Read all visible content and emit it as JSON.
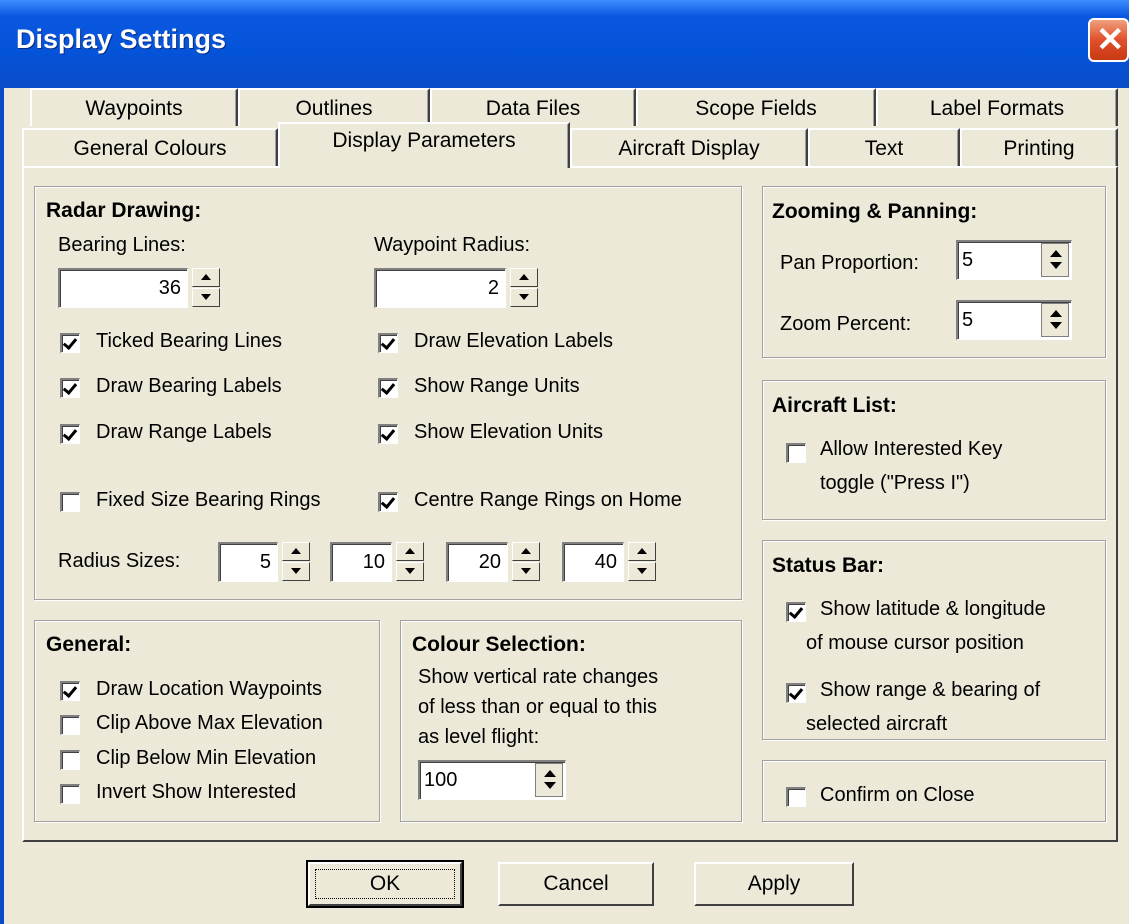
{
  "window": {
    "title": "Display Settings",
    "close_glyph": "✕"
  },
  "tabs_back": [
    "Waypoints",
    "Outlines",
    "Data Files",
    "Scope Fields",
    "Label Formats"
  ],
  "tabs_front": [
    "General Colours",
    "Display Parameters",
    "Aircraft Display",
    "Text",
    "Printing"
  ],
  "active_tab": "Display Parameters",
  "radar": {
    "title": "Radar Drawing:",
    "bearing_lines_label": "Bearing Lines:",
    "bearing_lines_value": "36",
    "waypoint_radius_label": "Waypoint Radius:",
    "waypoint_radius_value": "2",
    "checks": [
      {
        "label": "Ticked Bearing Lines",
        "checked": true
      },
      {
        "label": "Draw Elevation Labels",
        "checked": true
      },
      {
        "label": "Draw Bearing Labels",
        "checked": true
      },
      {
        "label": "Show Range Units",
        "checked": true
      },
      {
        "label": "Draw Range Labels",
        "checked": true
      },
      {
        "label": "Show Elevation Units",
        "checked": true
      },
      {
        "label": "Fixed Size Bearing Rings",
        "checked": false
      },
      {
        "label": "Centre Range Rings on Home",
        "checked": true
      }
    ],
    "radius_label": "Radius Sizes:",
    "radius_values": [
      "5",
      "10",
      "20",
      "40"
    ]
  },
  "zoom": {
    "title": "Zooming & Panning:",
    "pan_label": "Pan Proportion:",
    "pan_value": "5",
    "zoom_label": "Zoom Percent:",
    "zoom_value": "5"
  },
  "aircraft_list": {
    "title": "Aircraft List:",
    "check_line1": "Allow Interested Key",
    "check_line2": "toggle (\"Press I\")",
    "checked": false
  },
  "status_bar": {
    "title": "Status Bar:",
    "check1_line1": "Show latitude & longitude",
    "check1_line2": "of mouse cursor position",
    "check1_checked": true,
    "check2_line1": "Show range & bearing of",
    "check2_line2": "selected aircraft",
    "check2_checked": true
  },
  "confirm": {
    "label": "Confirm on Close",
    "checked": false
  },
  "general": {
    "title": "General:",
    "checks": [
      {
        "label": "Draw Location Waypoints",
        "checked": true
      },
      {
        "label": "Clip Above Max Elevation",
        "checked": false
      },
      {
        "label": "Clip Below Min Elevation",
        "checked": false
      },
      {
        "label": "Invert Show Interested",
        "checked": false
      }
    ]
  },
  "colour": {
    "title": "Colour Selection:",
    "line1": "Show vertical rate changes",
    "line2": "of less than or equal to this",
    "line3": "as level flight:",
    "value": "100"
  },
  "buttons": {
    "ok": "OK",
    "cancel": "Cancel",
    "apply": "Apply"
  }
}
